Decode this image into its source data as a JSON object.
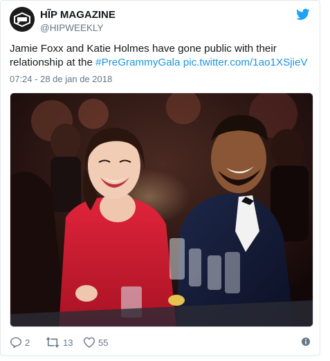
{
  "account": {
    "display_name": "HĨP MAGAZINE",
    "handle": "@HIPWEEKLY"
  },
  "tweet": {
    "text_before": "Jamie Foxx and Katie Holmes have gone public with their relationship at the ",
    "hashtag": "#PreGrammyGala",
    "link": "pic.twitter.com/1ao1XSjieV",
    "timestamp": "07:24 - 28 de jan de 2018"
  },
  "actions": {
    "reply_count": "2",
    "retweet_count": "13",
    "like_count": "55"
  },
  "icons": {
    "brand": "twitter-bird-icon",
    "reply": "reply-icon",
    "retweet": "retweet-icon",
    "like": "heart-icon",
    "info": "info-icon"
  },
  "colors": {
    "link": "#1b95e0",
    "muted": "#657786",
    "text": "#14171a",
    "bird": "#1da1f2"
  }
}
